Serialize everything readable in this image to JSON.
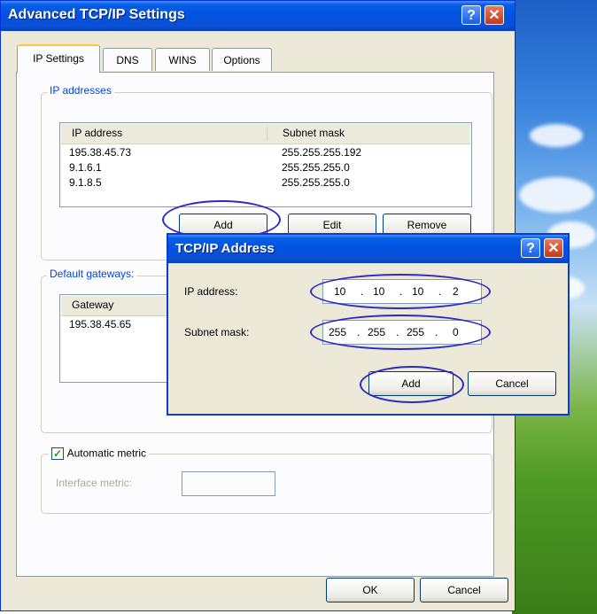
{
  "window": {
    "title": "Advanced TCP/IP Settings",
    "help_label": "?",
    "close_label": "✕"
  },
  "tabs": [
    {
      "label": "IP Settings",
      "active": true
    },
    {
      "label": "DNS",
      "active": false
    },
    {
      "label": "WINS",
      "active": false
    },
    {
      "label": "Options",
      "active": false
    }
  ],
  "ip_addresses": {
    "group_label": "IP addresses",
    "columns": [
      "IP address",
      "Subnet mask"
    ],
    "rows": [
      {
        "ip": "195.38.45.73",
        "mask": "255.255.255.192"
      },
      {
        "ip": "9.1.6.1",
        "mask": "255.255.255.0"
      },
      {
        "ip": "9.1.8.5",
        "mask": "255.255.255.0"
      }
    ],
    "buttons": {
      "add": "Add",
      "edit": "Edit",
      "remove": "Remove"
    }
  },
  "default_gateways": {
    "group_label": "Default gateways:",
    "columns": [
      "Gateway"
    ],
    "rows": [
      {
        "gateway": "195.38.45.65"
      }
    ]
  },
  "metric": {
    "checkbox_label": "Automatic metric",
    "checked": true,
    "interface_metric_label": "Interface metric:",
    "interface_metric_value": ""
  },
  "footer": {
    "ok": "OK",
    "cancel": "Cancel"
  },
  "dialog": {
    "title": "TCP/IP Address",
    "ip_label": "IP address:",
    "ip_octets": [
      "10",
      "10",
      "10",
      "2"
    ],
    "mask_label": "Subnet mask:",
    "mask_octets": [
      "255",
      "255",
      "255",
      "0"
    ],
    "add": "Add",
    "cancel": "Cancel"
  },
  "colors": {
    "title_bar": "#0054e3",
    "highlight_ring": "#2d29c5",
    "group_label": "#0046d5"
  }
}
